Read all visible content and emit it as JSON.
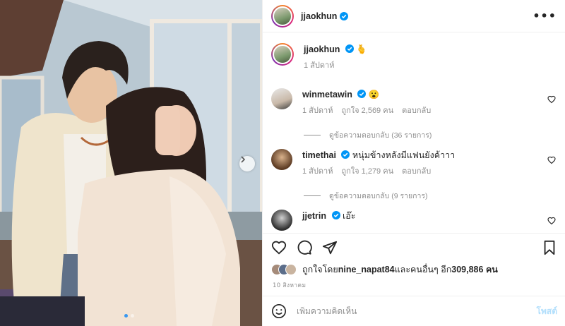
{
  "post": {
    "author": "jjaokhun",
    "more_label": "•••",
    "caption": {
      "username": "jjaokhun",
      "text": "🫰",
      "time": "1 สัปดาห์"
    },
    "comments": [
      {
        "username": "winmetawin",
        "text": "😮",
        "time": "1 สัปดาห์",
        "likes": "ถูกใจ 2,569 คน",
        "reply_label": "ตอบกลับ",
        "view_replies": "ดูข้อความตอบกลับ (36 รายการ)"
      },
      {
        "username": "timethai",
        "text": "หนุ่มข้างหลังมีแฟนยังค้าาา",
        "time": "1 สัปดาห์",
        "likes": "ถูกใจ 1,279 คน",
        "reply_label": "ตอบกลับ",
        "view_replies": "ดูข้อความตอบกลับ (9 รายการ)"
      },
      {
        "username": "jjetrin",
        "text": "เอ๊ะ"
      }
    ],
    "liked_by_prefix": "ถูกใจโดย ",
    "liked_by_user": "nine_napat84",
    "liked_by_suffix": " และคนอื่นๆ อีก ",
    "liked_by_count": "309,886 คน",
    "date": "10 สิงหาคม",
    "comment_placeholder": "เพิ่มความคิดเห็น",
    "post_button": "โพสต์",
    "carousel": {
      "slides": 2,
      "active": 0
    }
  },
  "icons": {
    "verified": "verified-badge-icon",
    "like": "heart-icon",
    "comment": "comment-bubble-icon",
    "share": "paper-plane-icon",
    "save": "bookmark-icon",
    "emoji": "smiley-icon",
    "next": "chevron-right-icon"
  },
  "colors": {
    "verified_blue": "#0095f6",
    "link_blue_disabled": "#b2dffc",
    "secondary_text": "#8e8e8e",
    "primary_text": "#262626"
  }
}
